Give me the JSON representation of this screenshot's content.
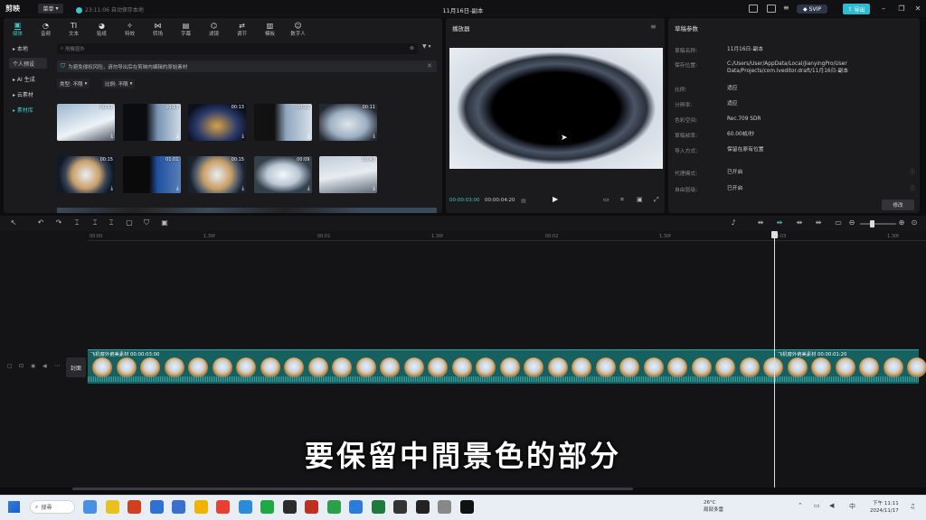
{
  "titlebar": {
    "logo": "剪映",
    "menu": "菜单",
    "autosave_time": "23:11:06",
    "autosave": "自动保存本地",
    "title": "11月16日-副本",
    "svip": "SVIP",
    "export": "导出"
  },
  "tabs": [
    {
      "icon": "▣",
      "label": "媒体"
    },
    {
      "icon": "◔",
      "label": "音频"
    },
    {
      "icon": "TI",
      "label": "文本"
    },
    {
      "icon": "◕",
      "label": "贴纸"
    },
    {
      "icon": "✧",
      "label": "特效"
    },
    {
      "icon": "⋈",
      "label": "转场"
    },
    {
      "icon": "▤",
      "label": "字幕"
    },
    {
      "icon": "⌬",
      "label": "滤镜"
    },
    {
      "icon": "⇄",
      "label": "调节"
    },
    {
      "icon": "▥",
      "label": "模板"
    },
    {
      "icon": "☺",
      "label": "数字人"
    }
  ],
  "sidebar": [
    {
      "label": "▸ 本地"
    },
    {
      "label": "个人预设"
    },
    {
      "label": "▸ AI 生成"
    },
    {
      "label": "▸ 云素材"
    },
    {
      "label": "▸ 素材库"
    }
  ],
  "media": {
    "search_placeholder": "飛機窗外",
    "filter": "▼ ▾",
    "notice": "为避免侵权风险，请勿导出后在剪映内编辑的原始素材",
    "type_filter": "类型: 不限",
    "ratio_filter": "比例: 不限",
    "thumbs": [
      {
        "dur": "00:12",
        "bg": "linear-gradient(160deg,#9ab6d0,#eef3f7 60%,#4a5260)"
      },
      {
        "dur": "00:13",
        "bg": "linear-gradient(90deg,#0a0c10 40%,#7a94b4 60%,#cfdbe7)"
      },
      {
        "dur": "00:13",
        "bg": "radial-gradient(ellipse at 50% 60%,#d8a248 0%,#2a3a6a 50%,#0b1020 80%)"
      },
      {
        "dur": "00:22",
        "bg": "linear-gradient(90deg,#111 35%,#8fa6be 55%,#d6e0ea)"
      },
      {
        "dur": "00:11",
        "bg": "radial-gradient(ellipse at 50% 55%,#dfe5ea 0%,#9fb0c4 45%,#242a34 80%)"
      },
      {
        "dur": "00:15",
        "bg": "radial-gradient(circle at 50% 50%,#e8eef4 0%,#c9a06a 40%,#3a4656 60%,#0f1a28 80%)"
      },
      {
        "dur": "01:01",
        "bg": "linear-gradient(90deg,#0a0a0a 45%,#2050a0 60%,#5a7fb8)"
      },
      {
        "dur": "00:15",
        "bg": "radial-gradient(circle at 50% 50%,#e9eef3 0%,#c79d64 42%,#5a6470 60%,#1a2230 80%)"
      },
      {
        "dur": "00:09",
        "bg": "radial-gradient(ellipse at 50% 50%,#f4f8fb 0%,#b9c6d3 40%,#35404d 70%)"
      },
      {
        "dur": "00:43",
        "bg": "linear-gradient(170deg,#c0ccd8,#e7ecf1 50%,#5d6672)"
      }
    ]
  },
  "player": {
    "title": "播放器",
    "time_current": "00:00:03:00",
    "time_total": "00:00:04:20"
  },
  "props": {
    "title": "草稿参数",
    "rows": [
      {
        "label": "草稿名称:",
        "value": "11月16日-副本"
      },
      {
        "label": "保存位置:",
        "value": "C:/Users/User/AppData/Local/JianyingPro/User Data/Projects/com.lveditor.draft/11月16日-副本"
      },
      {
        "label": "比例:",
        "value": "适应"
      },
      {
        "label": "分辨率:",
        "value": "适应"
      },
      {
        "label": "色彩空间:",
        "value": "Rec.709 SDR"
      },
      {
        "label": "草稿帧率:",
        "value": "60.00帧/秒"
      },
      {
        "label": "导入方式:",
        "value": "保留在原有位置"
      },
      {
        "label": "代理模式:",
        "value": "已开启"
      },
      {
        "label": "自由层级:",
        "value": "已开启"
      }
    ],
    "edit": "修改"
  },
  "timeline": {
    "ticks": [
      "00:00",
      "1.30f",
      "00:01",
      "1.30f",
      "00:02",
      "1.30f",
      "00:03",
      "1.30f"
    ],
    "cover": "封面",
    "clip1_name": "飞机窗外俯美素材  00:00:03:00",
    "clip2_name": "飞机窗外俯美素材  00:00:01:20"
  },
  "subtitle": "要保留中間景色的部分",
  "taskbar": {
    "search": "搜尋",
    "weather_temp": "26°C",
    "weather_desc": "局部多雲",
    "clock_time": "下午 11:11",
    "clock_date": "2024/11/17"
  }
}
